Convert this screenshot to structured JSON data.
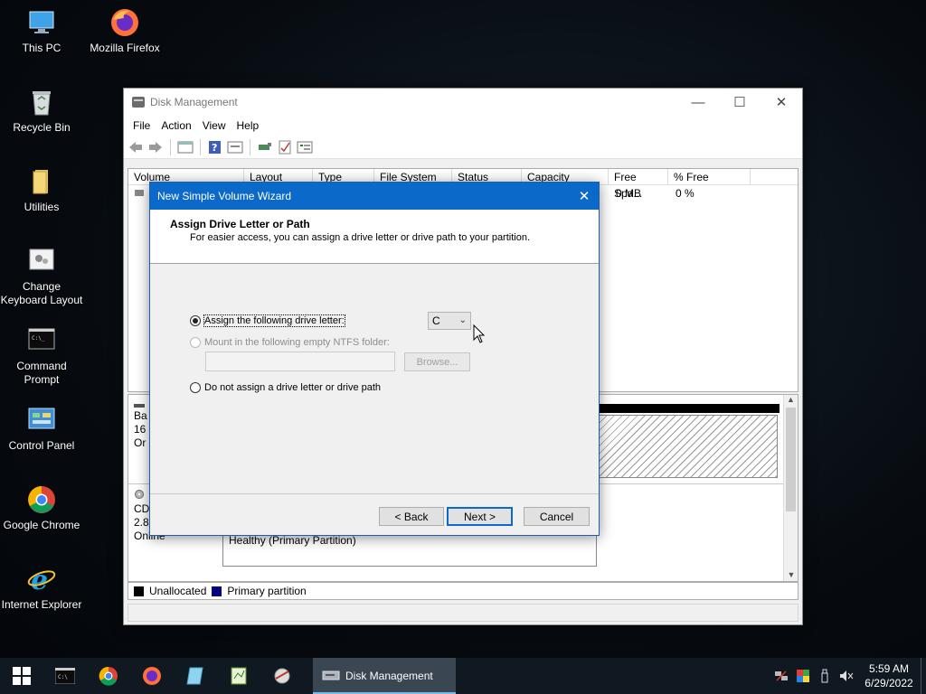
{
  "desktop": {
    "icons": [
      {
        "label": "This PC",
        "icon": "this-pc-icon"
      },
      {
        "label": "Mozilla Firefox",
        "icon": "firefox-icon"
      },
      {
        "label": "Recycle Bin",
        "icon": "recycle-bin-icon"
      },
      {
        "label": "Utilities",
        "icon": "folder-icon"
      },
      {
        "label": "Change Keyboard Layout",
        "icon": "keyboard-layout-icon"
      },
      {
        "label": "Command Prompt",
        "icon": "command-prompt-icon"
      },
      {
        "label": "Control Panel",
        "icon": "control-panel-icon"
      },
      {
        "label": "Google Chrome",
        "icon": "chrome-icon"
      },
      {
        "label": "Internet Explorer",
        "icon": "internet-explorer-icon"
      }
    ]
  },
  "window": {
    "title": "Disk Management",
    "menu": [
      "File",
      "Action",
      "View",
      "Help"
    ],
    "columns": [
      "Volume",
      "Layout",
      "Type",
      "File System",
      "Status",
      "Capacity",
      "Free Spa...",
      "% Free"
    ],
    "row": {
      "free_space": "0 MB",
      "percent_free": "0 %"
    },
    "disks": [
      {
        "line1": "Ba",
        "line2": "16",
        "line3": "Or"
      },
      {
        "line1": "CD",
        "line2": "2.8",
        "line3": "Online"
      }
    ],
    "partition_status": "Healthy (Primary Partition)",
    "legend": [
      {
        "label": "Unallocated",
        "color": "#000000"
      },
      {
        "label": "Primary partition",
        "color": "#000080"
      }
    ]
  },
  "wizard": {
    "title": "New Simple Volume Wizard",
    "heading": "Assign Drive Letter or Path",
    "subheading": "For easier access, you can assign a drive letter or drive path to your partition.",
    "option_assign": "Assign the following drive letter:",
    "drive_letter": "C",
    "option_mount": "Mount in the following empty NTFS folder:",
    "browse": "Browse...",
    "option_none": "Do not assign a drive letter or drive path",
    "back": "< Back",
    "next": "Next >",
    "cancel": "Cancel"
  },
  "taskbar": {
    "active_app": "Disk Management",
    "time": "5:59 AM",
    "date": "6/29/2022"
  }
}
